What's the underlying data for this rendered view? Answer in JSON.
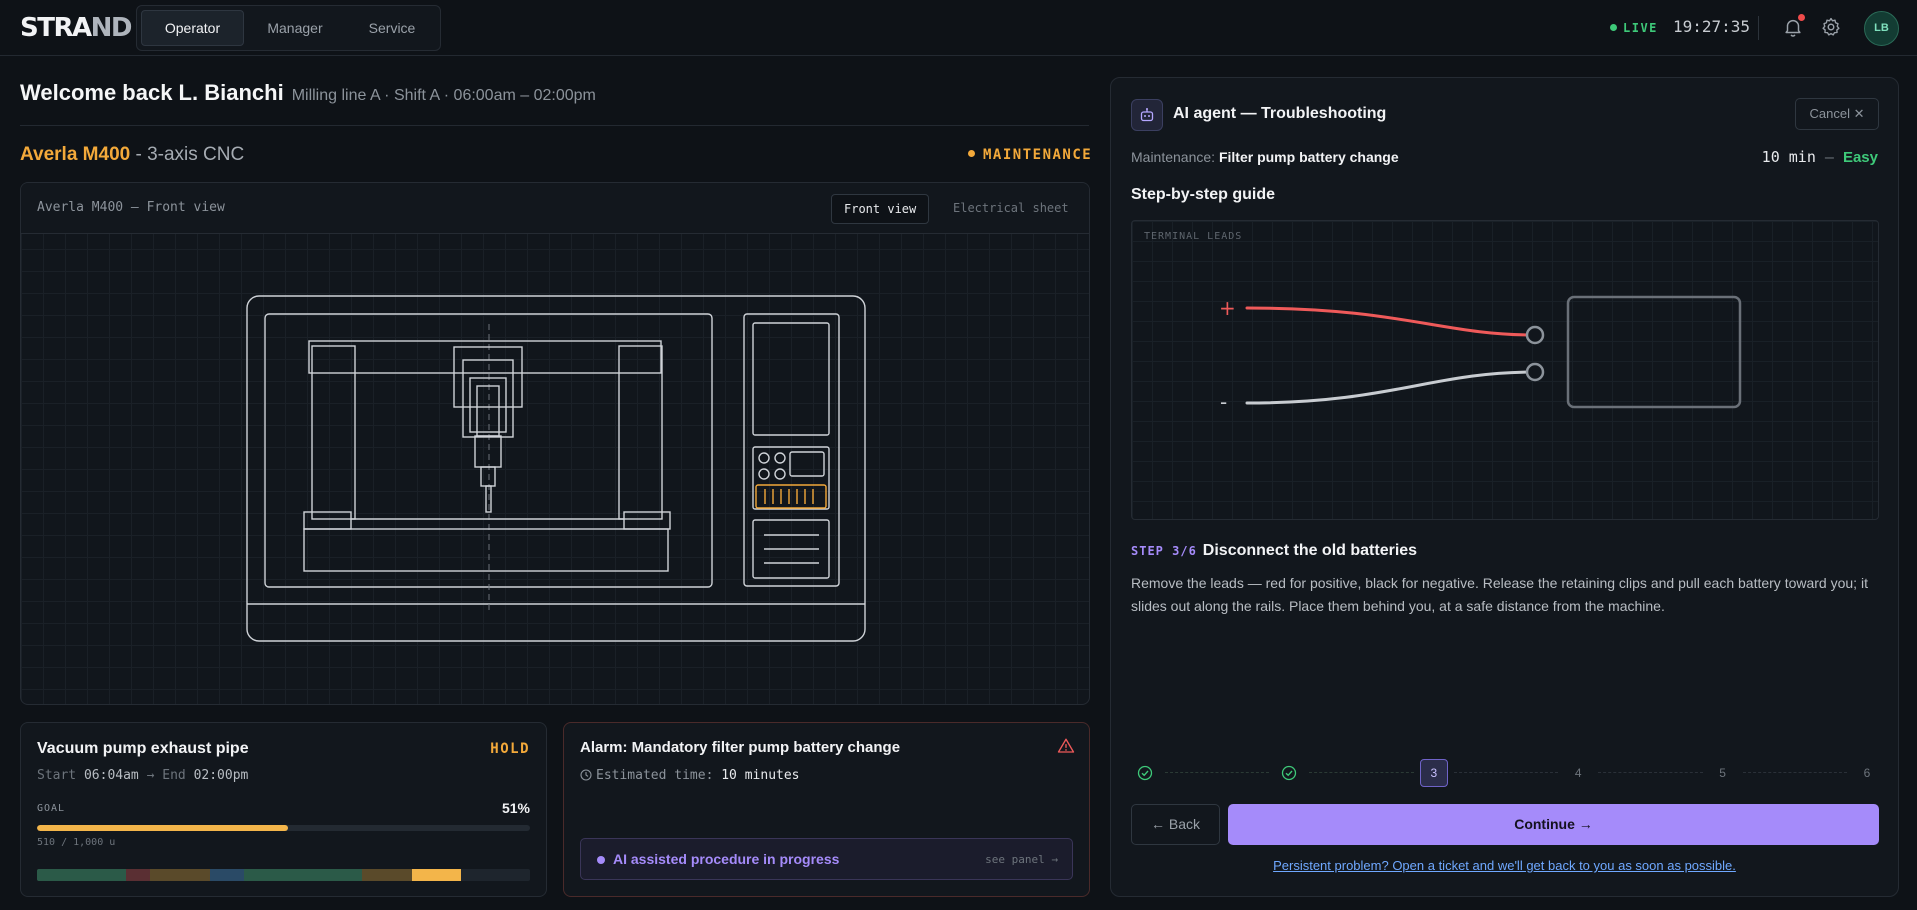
{
  "header": {
    "logo": "STRAND",
    "tabs": [
      {
        "label": "Operator",
        "active": true
      },
      {
        "label": "Manager",
        "active": false
      },
      {
        "label": "Service",
        "active": false
      }
    ],
    "live_label": "LIVE",
    "clock": "19:27:35",
    "avatar_initials": "LB",
    "icons": [
      "bell-icon",
      "gear-icon"
    ]
  },
  "welcome": {
    "title": "Welcome back L. Bianchi",
    "shift": "Milling line A · Shift A · 06:00am – 02:00pm"
  },
  "machine": {
    "name": "Averla M400",
    "type_suffix": " - 3-axis CNC",
    "status": "MAINTENANCE",
    "status_color": "#f3a93a",
    "viewer_label": "Averla M400 — Front view",
    "view_tabs": [
      {
        "label": "Front view",
        "active": true
      },
      {
        "label": "Electrical sheet",
        "active": false
      }
    ]
  },
  "job_card": {
    "title": "Vacuum pump exhaust pipe",
    "status": "HOLD",
    "start_label": "Start",
    "start": "06:04am",
    "arrow": "→",
    "end_label": "End",
    "end": "02:00pm",
    "goal_label": "GOAL",
    "percent_label": "51%",
    "progress": 0.51,
    "units": "510 / 1,000 u",
    "timeline_segments": [
      {
        "color": "#2b5a48",
        "share": 0.18
      },
      {
        "color": "#5a2f33",
        "share": 0.05
      },
      {
        "color": "#5a4a2a",
        "share": 0.12
      },
      {
        "color": "#2a4a66",
        "share": 0.07
      },
      {
        "color": "#2b5a48",
        "share": 0.24
      },
      {
        "color": "#5a4a2a",
        "share": 0.1
      },
      {
        "color": "#f3b54a",
        "share": 0.1
      }
    ]
  },
  "alarm_card": {
    "title": "Alarm: Mandatory filter pump battery change",
    "est_label": "Estimated time:",
    "est_value": "10 minutes",
    "ai_status": "AI assisted procedure in progress",
    "see_panel": "see panel →"
  },
  "agent_panel": {
    "title": "AI agent — Troubleshooting",
    "cancel_label": "Cancel",
    "maintenance_label": "Maintenance:",
    "maintenance_task": "Filter pump battery change",
    "duration": "10 min",
    "duration_sep": "—",
    "difficulty": "Easy",
    "guide_title": "Step-by-step guide",
    "diagram_label": "TERMINAL LEADS",
    "plus_sign": "+",
    "minus_sign": "-",
    "step_label": "STEP 3/6",
    "step_title": "Disconnect the old batteries",
    "step_desc": "Remove the leads — red for positive, black for negative. Release the retaining clips and pull each battery toward you; it slides out along the rails. Place them behind you, at a safe distance from the machine.",
    "steps": [
      {
        "label": "1",
        "state": "done"
      },
      {
        "label": "2",
        "state": "done"
      },
      {
        "label": "3",
        "state": "current"
      },
      {
        "label": "4",
        "state": "future"
      },
      {
        "label": "5",
        "state": "future"
      },
      {
        "label": "6",
        "state": "future"
      }
    ],
    "back_label": "Back",
    "continue_label": "Continue",
    "ticket_link": "Persistent problem? Open a ticket and we'll get back to you as soon as possible.",
    "accent_color": "#a58bfa"
  }
}
